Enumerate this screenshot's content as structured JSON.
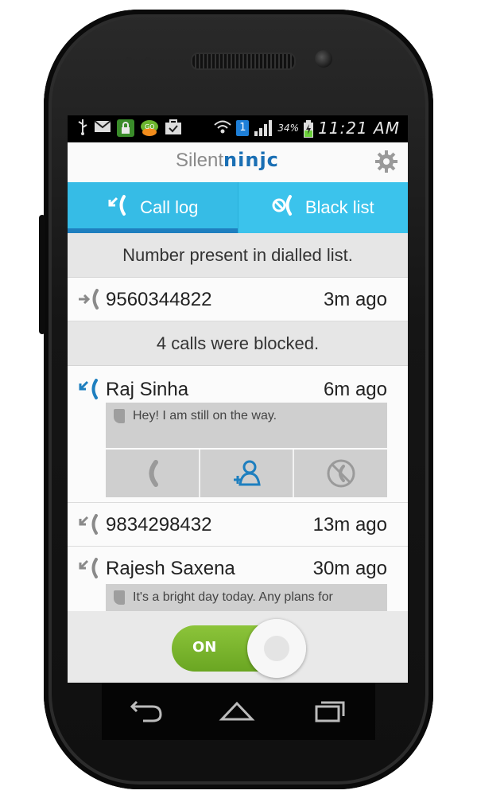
{
  "status_bar": {
    "battery_percent": "34%",
    "time": "11:21 AM",
    "sim_badge": "1"
  },
  "app": {
    "logo_part1": "Silent",
    "logo_part2": "ninjc"
  },
  "tabs": [
    {
      "label": "Call log",
      "active": true
    },
    {
      "label": "Black list",
      "active": false
    }
  ],
  "dialled_section": {
    "header": "Number present in dialled list.",
    "rows": [
      {
        "name": "9560344822",
        "time": "3m ago"
      }
    ]
  },
  "blocked_section": {
    "header": "4 calls were blocked.",
    "rows": [
      {
        "name": "Raj Sinha",
        "time": "6m ago",
        "message": "Hey! I am still on the way."
      },
      {
        "name": "9834298432",
        "time": "13m ago"
      },
      {
        "name": "Rajesh Saxena",
        "time": "30m ago",
        "message": "It's a bright day today. Any plans for"
      }
    ]
  },
  "toggle": {
    "label": "ON",
    "state": "on"
  },
  "colors": {
    "accent": "#3bc3ec",
    "accent_dark": "#1e7fbf",
    "toggle_on": "#7cb82f"
  }
}
